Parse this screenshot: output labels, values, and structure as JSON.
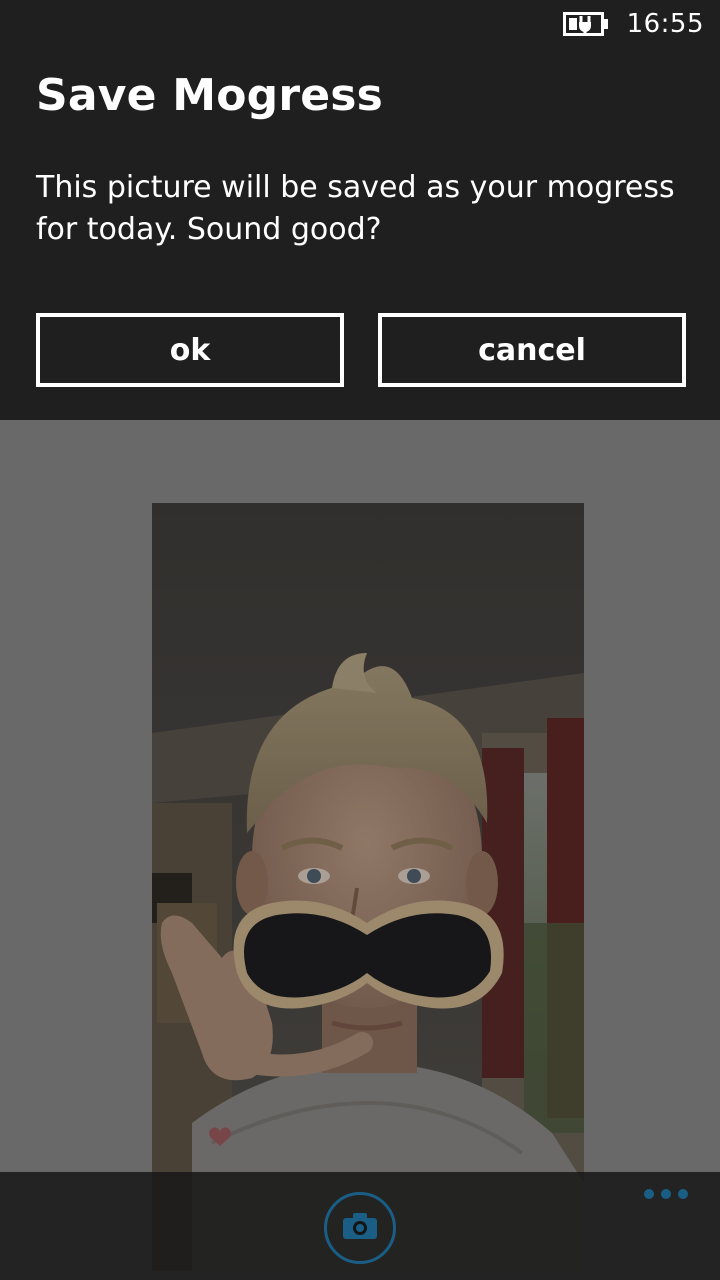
{
  "status_bar": {
    "time": "16:55",
    "battery_icon": "battery-charging-icon"
  },
  "dialog": {
    "title": "Save Mogress",
    "message": "This picture will be saved as your mogress for today. Sound good?",
    "ok_label": "ok",
    "cancel_label": "cancel"
  },
  "app_bar": {
    "camera_icon": "camera-icon",
    "more_icon": "ellipsis-icon"
  },
  "colors": {
    "dialog_background": "#1f1f1f",
    "overlay_background": "#696969",
    "accent": "#1a5e86",
    "text": "#ffffff"
  }
}
